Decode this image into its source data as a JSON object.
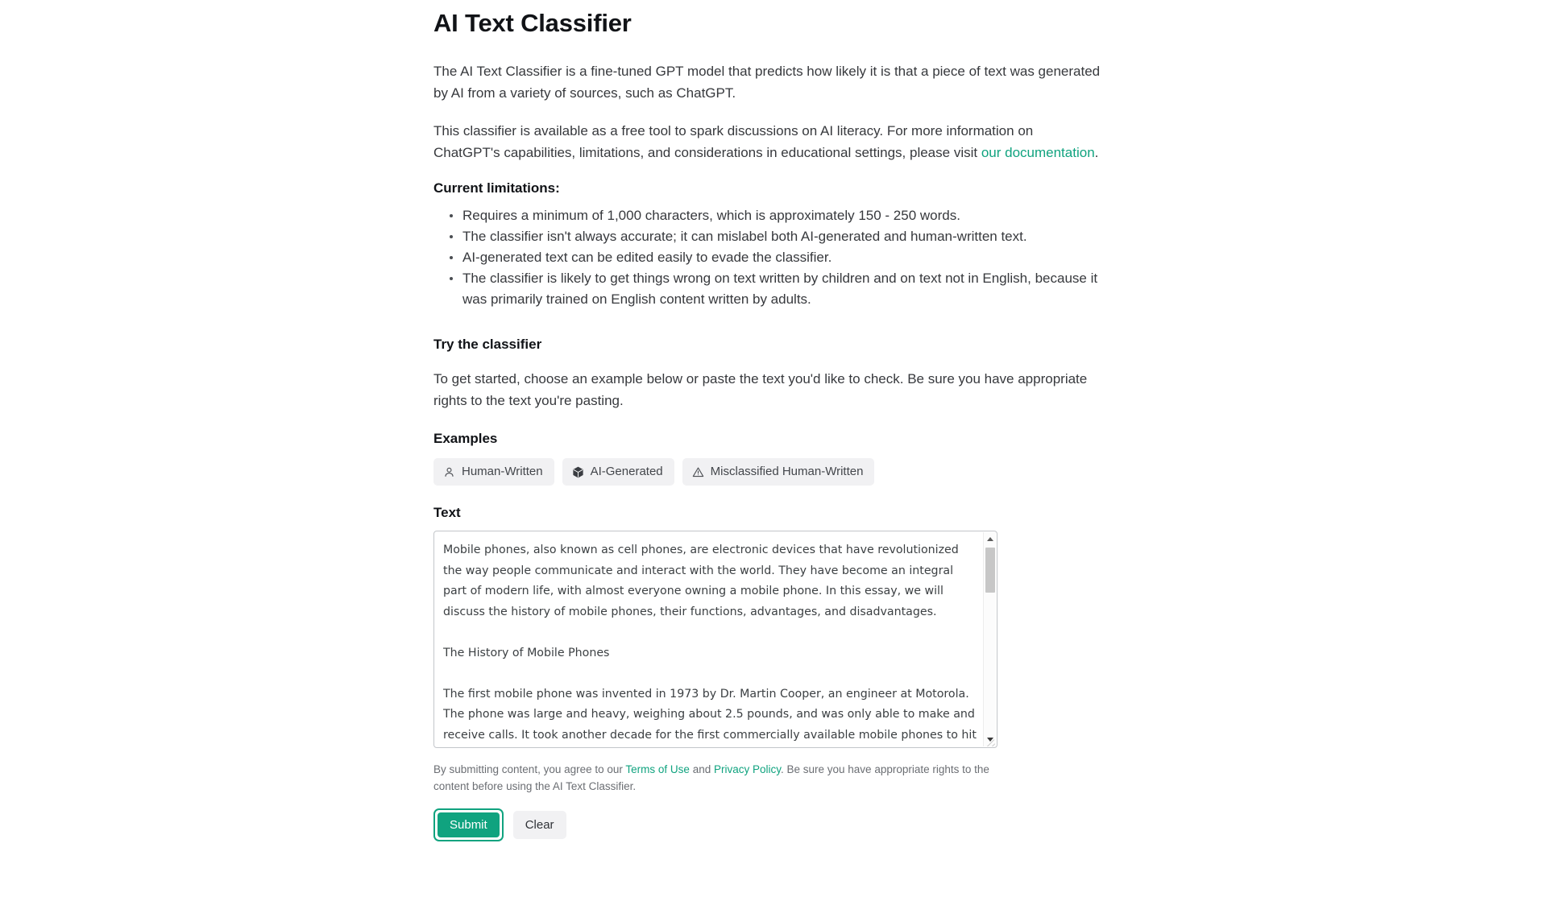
{
  "page": {
    "title": "AI Text Classifier",
    "intro_paragraph": "The AI Text Classifier is a fine-tuned GPT model that predicts how likely it is that a piece of text was generated by AI from a variety of sources, such as ChatGPT.",
    "availability_prefix": "This classifier is available as a free tool to spark discussions on AI literacy. For more information on ChatGPT's capabilities, limitations, and considerations in educational settings, please visit ",
    "availability_link": "our documentation",
    "availability_suffix": "."
  },
  "limitations": {
    "heading": "Current limitations:",
    "items": [
      "Requires a minimum of 1,000 characters, which is approximately 150 - 250 words.",
      "The classifier isn't always accurate; it can mislabel both AI-generated and human-written text.",
      "AI-generated text can be edited easily to evade the classifier.",
      "The classifier is likely to get things wrong on text written by children and on text not in English, because it was primarily trained on English content written by adults."
    ]
  },
  "try": {
    "heading": "Try the classifier",
    "instructions": "To get started, choose an example below or paste the text you'd like to check. Be sure you have appropriate rights to the text you're pasting."
  },
  "examples": {
    "label": "Examples",
    "chips": [
      {
        "label": "Human-Written",
        "icon": "person-icon"
      },
      {
        "label": "AI-Generated",
        "icon": "cube-icon"
      },
      {
        "label": "Misclassified Human-Written",
        "icon": "warning-triangle-icon"
      }
    ]
  },
  "text_field": {
    "label": "Text",
    "value": "Mobile phones, also known as cell phones, are electronic devices that have revolutionized the way people communicate and interact with the world. They have become an integral part of modern life, with almost everyone owning a mobile phone. In this essay, we will discuss the history of mobile phones, their functions, advantages, and disadvantages.\n\nThe History of Mobile Phones\n\nThe first mobile phone was invented in 1973 by Dr. Martin Cooper, an engineer at Motorola. The phone was large and heavy, weighing about 2.5 pounds, and was only able to make and receive calls. It took another decade for the first commercially available mobile phones to hit the market. These phones were expensive and only available to the wealthy.",
    "placeholder": ""
  },
  "disclaimer": {
    "prefix": "By submitting content, you agree to our ",
    "terms_link": "Terms of Use",
    "middle": " and ",
    "privacy_link": "Privacy Policy",
    "suffix": ". Be sure you have appropriate rights to the content before using the AI Text Classifier."
  },
  "actions": {
    "submit_label": "Submit",
    "clear_label": "Clear"
  },
  "colors": {
    "accent": "#10a37f",
    "text": "#37393d",
    "heading": "#111317",
    "chip_bg": "#f1f1f3",
    "muted": "#6b6e73"
  }
}
